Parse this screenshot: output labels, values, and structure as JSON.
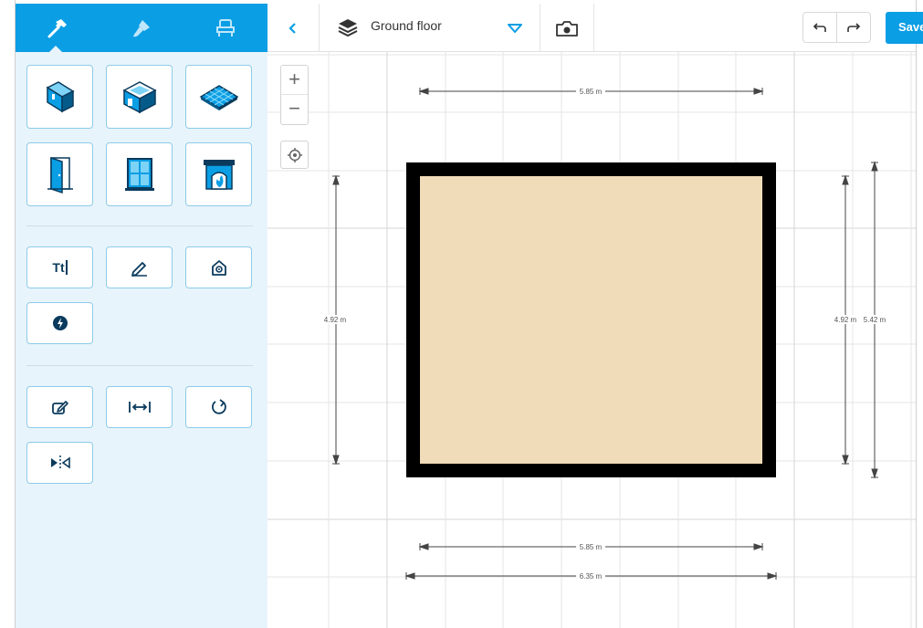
{
  "sidebar": {
    "tabs": [
      {
        "name": "build",
        "icon": "hammer-icon",
        "active": true
      },
      {
        "name": "decorate",
        "icon": "paint-brush-icon",
        "active": false
      },
      {
        "name": "furnish",
        "icon": "armchair-icon",
        "active": false
      }
    ],
    "tools_build": [
      {
        "icon": "wall-icon"
      },
      {
        "icon": "room-icon"
      },
      {
        "icon": "floor-surface-icon"
      },
      {
        "icon": "door-icon"
      },
      {
        "icon": "window-icon"
      },
      {
        "icon": "fireplace-icon"
      }
    ],
    "tools_annotate": [
      {
        "icon": "text-tool-icon",
        "label": "Tt"
      },
      {
        "icon": "pencil-icon"
      },
      {
        "icon": "location-pin-icon"
      },
      {
        "icon": "electrical-icon"
      }
    ],
    "tools_edit": [
      {
        "icon": "edit-icon"
      },
      {
        "icon": "resize-icon"
      },
      {
        "icon": "rotate-icon"
      },
      {
        "icon": "mirror-icon"
      }
    ]
  },
  "toolbar": {
    "back_icon": "chevron-left-icon",
    "layers_icon": "layers-icon",
    "floor_label": "Ground floor",
    "floor_dropdown_icon": "triangle-down-icon",
    "camera_icon": "camera-icon",
    "undo_icon": "undo-icon",
    "redo_icon": "redo-icon",
    "save_label": "Save"
  },
  "canvas": {
    "zoom_in_label": "+",
    "zoom_out_label": "−",
    "center_icon": "crosshair-icon",
    "dimensions": {
      "top": "5.85 m",
      "left": "4.92 m",
      "right_inner": "4.92 m",
      "right_outer": "5.42 m",
      "bottom_inner": "5.85 m",
      "bottom_outer": "6.35 m"
    },
    "colors": {
      "accent": "#0a9ee5",
      "room_floor": "#f0dcb8",
      "wall": "#000000",
      "grid": "#e6e6e6"
    }
  }
}
